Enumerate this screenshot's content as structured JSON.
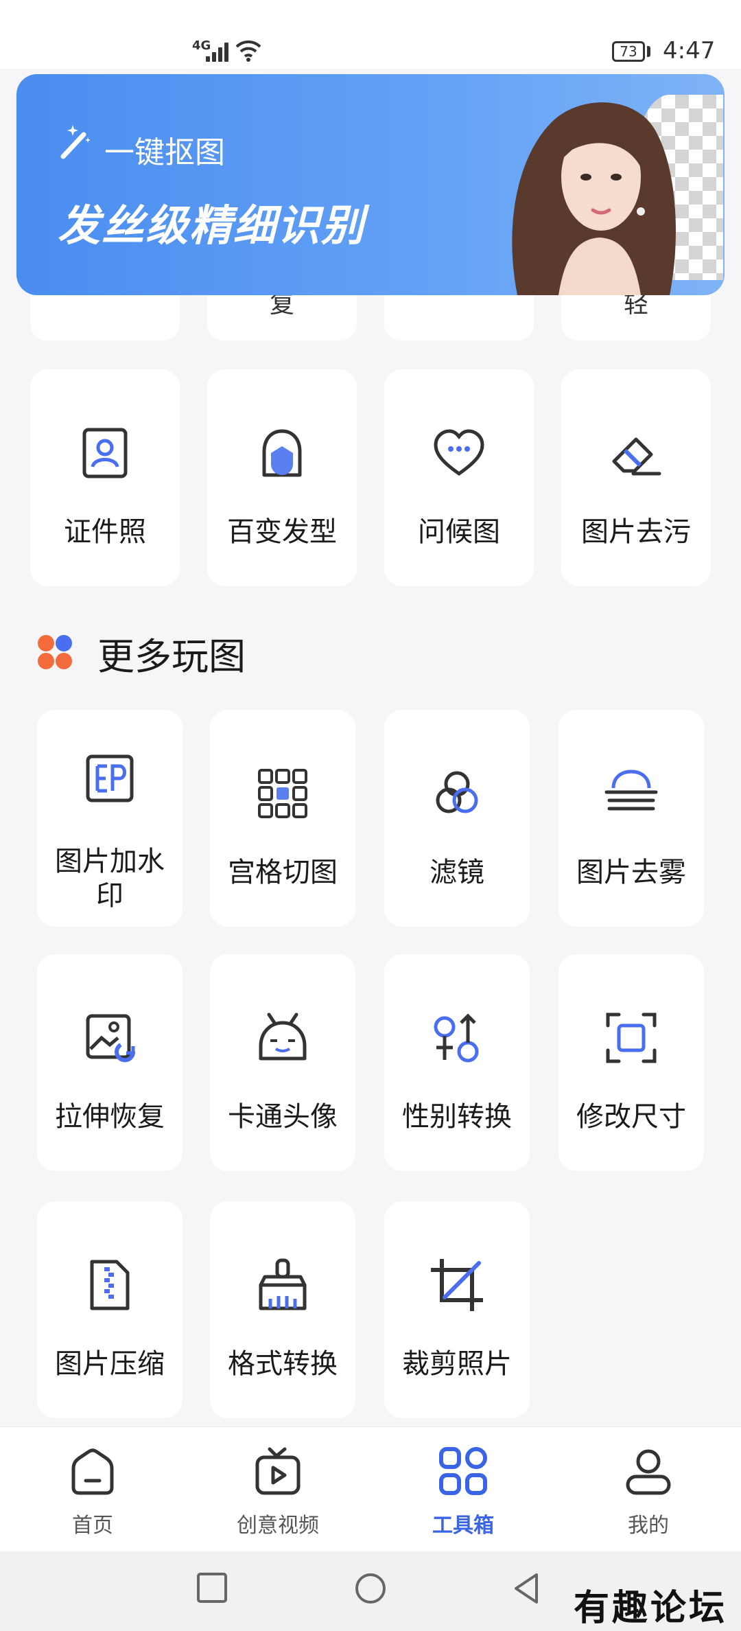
{
  "status_bar": {
    "network": "4G",
    "battery": "73",
    "time": "4:47"
  },
  "banner": {
    "kicker": "一键抠图",
    "headline": "发丝级精细识别"
  },
  "partial_row": [
    "",
    "复",
    "",
    "轻"
  ],
  "tools_row": [
    {
      "label": "证件照",
      "icon": "id-photo-icon"
    },
    {
      "label": "百变发型",
      "icon": "hairstyle-icon"
    },
    {
      "label": "问候图",
      "icon": "greeting-heart-icon"
    },
    {
      "label": "图片去污",
      "icon": "eraser-icon"
    }
  ],
  "more_section": {
    "title": "更多玩图",
    "items": [
      {
        "label": "图片加水印",
        "icon": "watermark-icon"
      },
      {
        "label": "宫格切图",
        "icon": "grid-cut-icon"
      },
      {
        "label": "滤镜",
        "icon": "filter-icon"
      },
      {
        "label": "图片去雾",
        "icon": "dehaze-icon"
      },
      {
        "label": "拉伸恢复",
        "icon": "stretch-restore-icon"
      },
      {
        "label": "卡通头像",
        "icon": "cartoon-avatar-icon"
      },
      {
        "label": "性别转换",
        "icon": "gender-swap-icon"
      },
      {
        "label": "修改尺寸",
        "icon": "resize-icon"
      },
      {
        "label": "图片压缩",
        "icon": "compress-icon"
      },
      {
        "label": "格式转换",
        "icon": "format-convert-icon"
      },
      {
        "label": "裁剪照片",
        "icon": "crop-icon"
      }
    ]
  },
  "bottom_nav": [
    {
      "label": "首页",
      "icon": "home-icon",
      "active": false
    },
    {
      "label": "创意视频",
      "icon": "video-icon",
      "active": false
    },
    {
      "label": "工具箱",
      "icon": "toolbox-icon",
      "active": true
    },
    {
      "label": "我的",
      "icon": "profile-icon",
      "active": false
    }
  ],
  "watermark": "有趣论坛",
  "colors": {
    "accent": "#3a64e6",
    "banner": "#5b9bf4",
    "icon_dark": "#333333"
  }
}
